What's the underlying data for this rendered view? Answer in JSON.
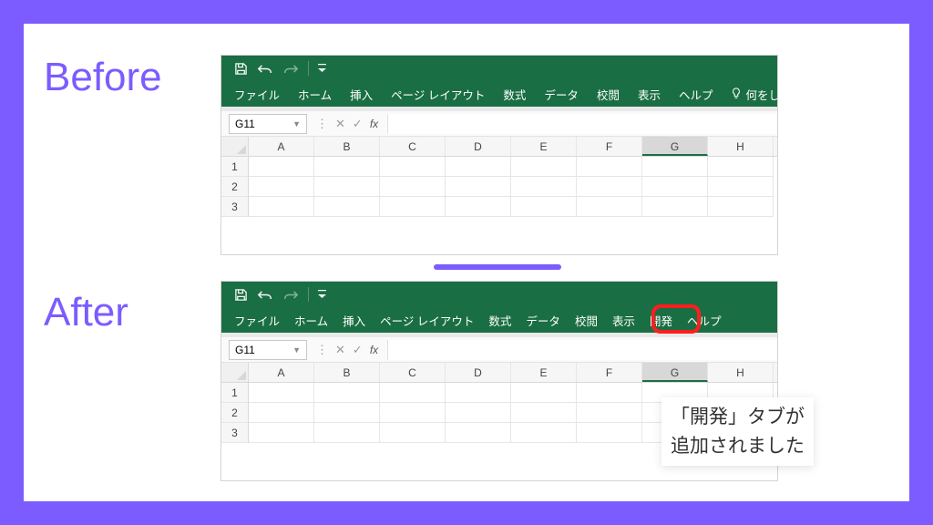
{
  "labels": {
    "before": "Before",
    "after": "After"
  },
  "excel": {
    "cell_ref": "G11",
    "fx_label": "fx",
    "tell_me": "何をし",
    "tabs_before": [
      "ファイル",
      "ホーム",
      "挿入",
      "ページ レイアウト",
      "数式",
      "データ",
      "校閲",
      "表示",
      "ヘルプ"
    ],
    "tabs_after": [
      "ファイル",
      "ホーム",
      "挿入",
      "ページ レイアウト",
      "数式",
      "データ",
      "校閲",
      "表示",
      "開発",
      "ヘルプ"
    ],
    "cols": [
      "A",
      "B",
      "C",
      "D",
      "E",
      "F",
      "G",
      "H"
    ],
    "rows": [
      "1",
      "2",
      "3"
    ]
  },
  "callout": {
    "line1": "「開発」タブが",
    "line2": "追加されました"
  },
  "highlight_tab_index": 8
}
